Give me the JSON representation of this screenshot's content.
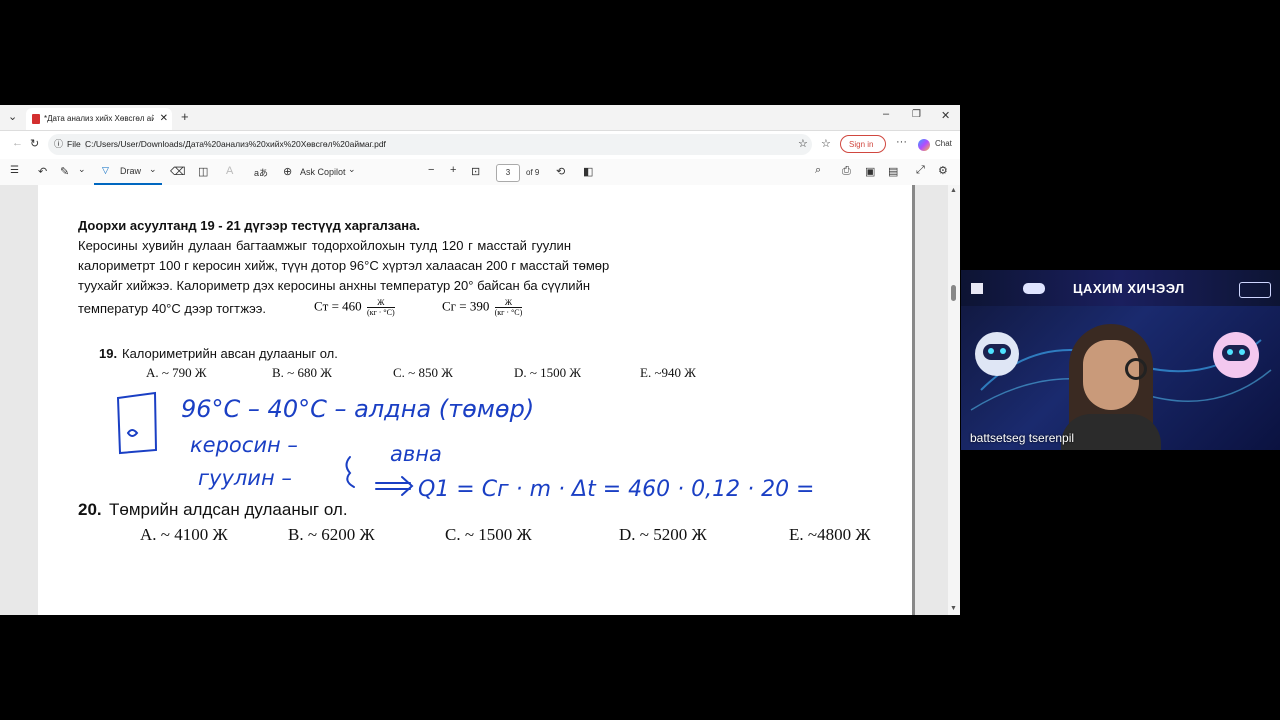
{
  "browser": {
    "tab_title": "*Дата анализ хийх Хөвсгөл аймаг",
    "tab_close": "✕",
    "new_tab": "+",
    "address_prefix": "File",
    "url": "C:/Users/User/Downloads/Дата%20анализ%20хийх%20Хөвсгөл%20аймаг.pdf",
    "sign_in": "Sign in",
    "chat": "Chat",
    "more": "···"
  },
  "pdf_toolbar": {
    "draw_label": "Draw",
    "ask_copilot": "Ask Copilot",
    "zoom_out": "−",
    "zoom_in": "+",
    "page_current": "3",
    "page_total": "of 9"
  },
  "document": {
    "heading": "Доорхи асуултанд 19 - 21 дүгээр тестүүд харгалзана.",
    "para_line1": "Керосины    хувийн дулаан багтаамжыг   тодорхойлохын тулд   120 г масстай гуулин",
    "para_line2": "калориметрт 100 г керосин хийж, түүн дотор 96°C хүртэл халаасан 200 г масстай төмөр",
    "para_line3": "туухайг хийжээ.  Калориметр дэх керосины анхны  температур 20° байсан ба сүүлийн",
    "para_line4": "температур 40°C дээр тогтжээ.",
    "formula_ct": "Cт = 460",
    "formula_cg": "Cг = 390",
    "formula_unit_num": "Ж",
    "formula_unit_den": "(кг · °C)",
    "q19_number": "19.",
    "q19_text": "Калориметрийн авсан дулааныг ол.",
    "q19_options": [
      "A. ~ 790 Ж",
      "B. ~ 680 Ж",
      "C. ~ 850 Ж",
      "D. ~ 1500 Ж",
      "E. ~940 Ж"
    ],
    "q20_number": "20.",
    "q20_text": "Төмрийн  алдсан дулааныг ол.",
    "q20_options": [
      "A. ~ 4100 Ж",
      "B. ~ 6200 Ж",
      "C. ~ 1500 Ж",
      "D. ~ 5200 Ж",
      "E. ~4800 Ж"
    ]
  },
  "handwriting": {
    "line1": "96°C – 40°C – алдна (төмөр)",
    "line2": "керосин –",
    "line3": "гуулин –",
    "brace_word": "авна",
    "line4": "Q1 = Cг · m · Δt = 460 · 0,12 · 20 =",
    "ink_color": "#1a3fc4"
  },
  "video": {
    "banner": "ЦАХИМ ХИЧЭЭЛ",
    "participant_name": "battsetseg tserenpil"
  }
}
